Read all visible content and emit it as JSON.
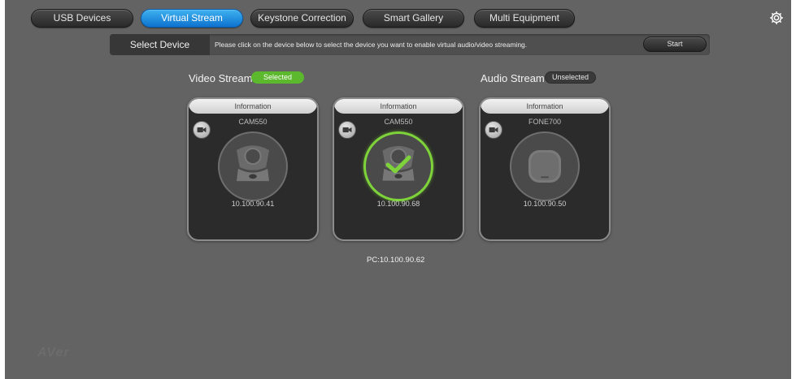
{
  "tabs": [
    {
      "label": "USB Devices",
      "active": false
    },
    {
      "label": "Virtual Stream",
      "active": true
    },
    {
      "label": "Keystone Correction",
      "active": false
    },
    {
      "label": "Smart Gallery",
      "active": false
    },
    {
      "label": "Multi Equipment",
      "active": false
    }
  ],
  "select_bar": {
    "label": "Select Device",
    "instruction": "Please click on the device below to select the device you want to enable virtual audio/video streaming.",
    "start_label": "Start"
  },
  "video_stream": {
    "title": "Video Stream",
    "status": "Selected"
  },
  "audio_stream": {
    "title": "Audio Stream",
    "status": "Unselected"
  },
  "devices": [
    {
      "info": "Information",
      "name": "CAM550",
      "ip": "10.100.90.41",
      "type": "camera",
      "selected": false
    },
    {
      "info": "Information",
      "name": "CAM550",
      "ip": "10.100.90.68",
      "type": "camera",
      "selected": true
    },
    {
      "info": "Information",
      "name": "FONE700",
      "ip": "10.100.90.50",
      "type": "speakerphone",
      "selected": false
    }
  ],
  "pc_ip": "PC:10.100.90.62",
  "logo_text": "AVer",
  "colors": {
    "background": "#636363",
    "active_tab": "#1a8ae0",
    "selected_pill": "#5cb82c",
    "check_ring": "#7ed23a"
  }
}
